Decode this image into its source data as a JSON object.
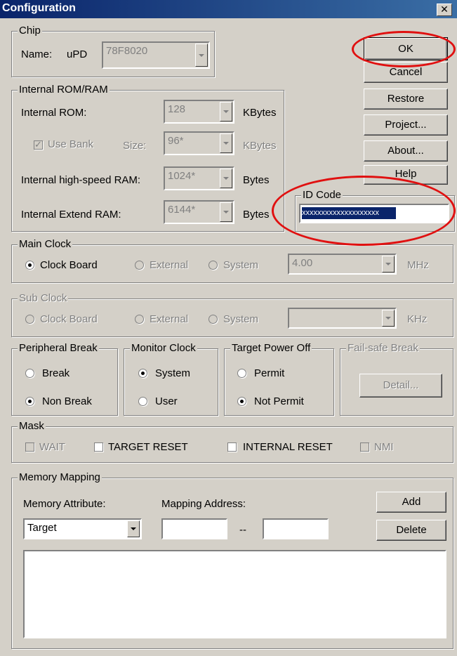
{
  "window": {
    "title": "Configuration",
    "close_glyph": "✕"
  },
  "chip": {
    "legend": "Chip",
    "name_label": "Name:",
    "prefix": "uPD",
    "value": "78F8020"
  },
  "rom_ram": {
    "legend": "Internal ROM/RAM",
    "rom": {
      "label": "Internal ROM:",
      "value": "128",
      "unit": "KBytes"
    },
    "bank": {
      "label": "Use Bank",
      "size_label": "Size:",
      "value": "96*",
      "unit": "KBytes",
      "checked": true
    },
    "hs_ram": {
      "label": "Internal high-speed RAM:",
      "value": "1024*",
      "unit": "Bytes"
    },
    "ext_ram": {
      "label": "Internal Extend RAM:",
      "value": "6144*",
      "unit": "Bytes"
    }
  },
  "buttons": {
    "ok": "OK",
    "cancel": "Cancel",
    "restore": "Restore",
    "project": "Project...",
    "about": "About...",
    "help": "Help"
  },
  "id_code": {
    "legend": "ID Code",
    "value": "xxxxxxxxxxxxxxxxxxxx"
  },
  "main_clock": {
    "legend": "Main Clock",
    "options": [
      "Clock Board",
      "External",
      "System"
    ],
    "selected": "Clock Board",
    "value": "4.00",
    "unit": "MHz"
  },
  "sub_clock": {
    "legend": "Sub Clock",
    "options": [
      "Clock Board",
      "External",
      "System"
    ],
    "value": "",
    "unit": "KHz"
  },
  "peripheral_break": {
    "legend": "Peripheral Break",
    "options": [
      "Break",
      "Non Break"
    ],
    "selected": "Non Break"
  },
  "monitor_clock": {
    "legend": "Monitor Clock",
    "options": [
      "System",
      "User"
    ],
    "selected": "System"
  },
  "target_power_off": {
    "legend": "Target Power Off",
    "options": [
      "Permit",
      "Not Permit"
    ],
    "selected": "Not Permit"
  },
  "fail_safe": {
    "legend": "Fail-safe Break",
    "detail": "Detail..."
  },
  "mask": {
    "legend": "Mask",
    "items": [
      "WAIT",
      "TARGET RESET",
      "INTERNAL RESET",
      "NMI"
    ]
  },
  "memory_mapping": {
    "legend": "Memory Mapping",
    "attr_label": "Memory Attribute:",
    "addr_label": "Mapping Address:",
    "attr_value": "Target",
    "separator": "--",
    "add": "Add",
    "delete": "Delete"
  },
  "colors": {
    "title_start": "#0a246a",
    "title_end": "#3a6ea5",
    "face": "#d4d0c8",
    "highlight_ellipse": "#e01010"
  }
}
